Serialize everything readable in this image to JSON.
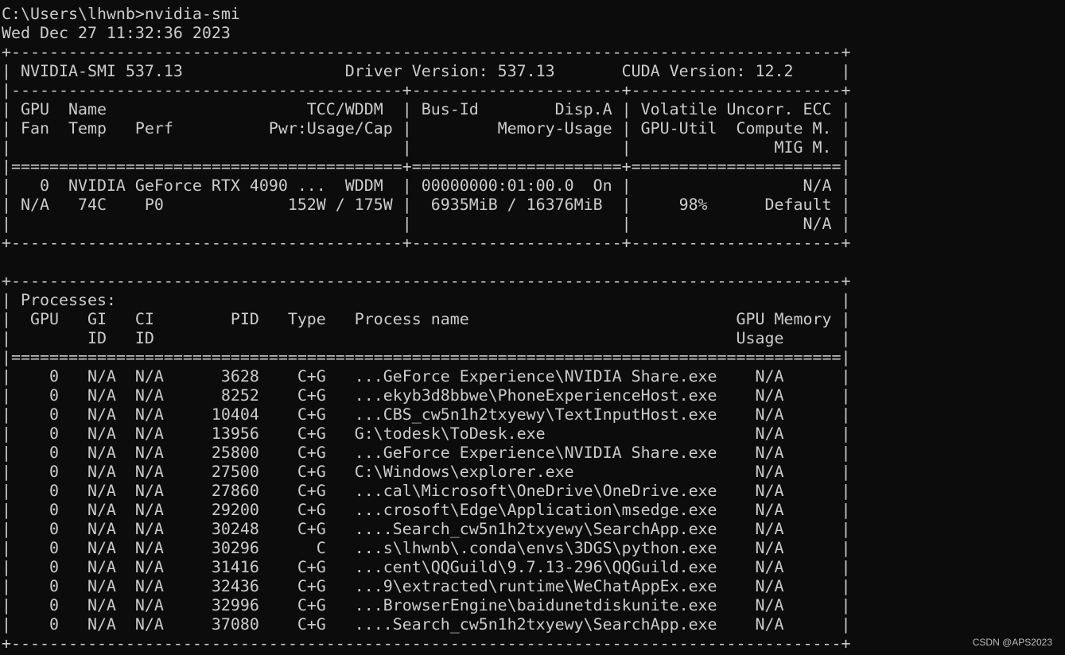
{
  "terminal": {
    "prompt": "C:\\Users\\lhwnb>nvidia-smi",
    "timestamp": "Wed Dec 27 11:32:36 2023",
    "lines": [
      "+---------------------------------------------------------------------------------------+",
      "| NVIDIA-SMI 537.13                 Driver Version: 537.13       CUDA Version: 12.2     |",
      "|-----------------------------------------+----------------------+----------------------+",
      "| GPU  Name                     TCC/WDDM  | Bus-Id        Disp.A | Volatile Uncorr. ECC |",
      "| Fan  Temp   Perf          Pwr:Usage/Cap |         Memory-Usage | GPU-Util  Compute M. |",
      "|                                         |                      |               MIG M. |",
      "|=========================================+======================+======================|",
      "|   0  NVIDIA GeForce RTX 4090 ...  WDDM  | 00000000:01:00.0  On |                  N/A |",
      "| N/A   74C    P0             152W / 175W |  6935MiB / 16376MiB  |     98%      Default |",
      "|                                         |                      |                  N/A |",
      "+-----------------------------------------+----------------------+----------------------+",
      "",
      "+---------------------------------------------------------------------------------------+",
      "| Processes:                                                                            |",
      "|  GPU   GI   CI        PID   Type   Process name                            GPU Memory |",
      "|        ID   ID                                                             Usage      |",
      "|=======================================================================================|",
      "|    0   N/A  N/A      3628    C+G   ...GeForce Experience\\NVIDIA Share.exe    N/A      |",
      "|    0   N/A  N/A      8252    C+G   ...ekyb3d8bbwe\\PhoneExperienceHost.exe    N/A      |",
      "|    0   N/A  N/A     10404    C+G   ...CBS_cw5n1h2txyewy\\TextInputHost.exe    N/A      |",
      "|    0   N/A  N/A     13956    C+G   G:\\todesk\\ToDesk.exe                      N/A      |",
      "|    0   N/A  N/A     25800    C+G   ...GeForce Experience\\NVIDIA Share.exe    N/A      |",
      "|    0   N/A  N/A     27500    C+G   C:\\Windows\\explorer.exe                   N/A      |",
      "|    0   N/A  N/A     27860    C+G   ...cal\\Microsoft\\OneDrive\\OneDrive.exe    N/A      |",
      "|    0   N/A  N/A     29200    C+G   ...crosoft\\Edge\\Application\\msedge.exe    N/A      |",
      "|    0   N/A  N/A     30248    C+G   ....Search_cw5n1h2txyewy\\SearchApp.exe    N/A      |",
      "|    0   N/A  N/A     30296      C   ...s\\lhwnb\\.conda\\envs\\3DGS\\python.exe    N/A      |",
      "|    0   N/A  N/A     31416    C+G   ...cent\\QQGuild\\9.7.13-296\\QQGuild.exe    N/A      |",
      "|    0   N/A  N/A     32436    C+G   ...9\\extracted\\runtime\\WeChatAppEx.exe    N/A      |",
      "|    0   N/A  N/A     32996    C+G   ...BrowserEngine\\baidunetdiskunite.exe    N/A      |",
      "|    0   N/A  N/A     37080    C+G   ....Search_cw5n1h2txyewy\\SearchApp.exe    N/A      |",
      "+---------------------------------------------------------------------------------------+"
    ]
  },
  "watermark": "CSDN @APS2023"
}
